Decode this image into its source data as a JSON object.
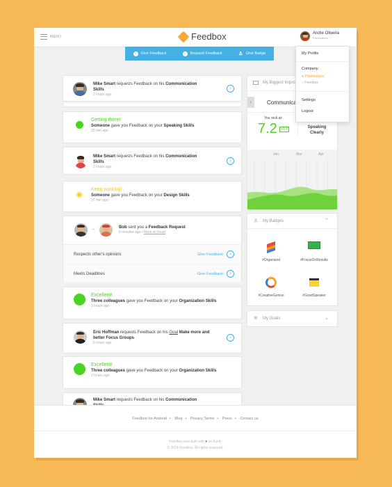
{
  "header": {
    "menu_label": "MENU",
    "logo_text": "Feedbox",
    "user_name": "Andre Oliveira",
    "user_company": "Pixelmatters"
  },
  "dropdown": {
    "my_profile": "My Profile",
    "company_label": "Company:",
    "company_active": "Pixelmatters",
    "company_other": "Feedbox",
    "settings": "Settings",
    "logout": "Logout"
  },
  "actions": {
    "give": "Give Feedback",
    "request": "Request Feedback",
    "badge": "Give Badge"
  },
  "feed": [
    {
      "name": "Mike Smart",
      "mid": " requests Feedback on his ",
      "topic": "Communication Skills",
      "time": "2 hours ago"
    },
    {
      "title": "Getting there!",
      "pre": "Someone",
      "mid": " gave you Feedback on your ",
      "topic": "Speaking Skills",
      "time": "25 min ago"
    },
    {
      "name": "Mike Smart",
      "mid": " requests Feedback on his ",
      "topic": "Communication Skills",
      "time": "2 hours ago"
    },
    {
      "title": "Keep working!",
      "pre": "Someone",
      "mid": " gave you Feedback on your ",
      "topic": "Design Skills",
      "time": "37 min ago"
    },
    {
      "name": "Bob",
      "mid": " sent you a ",
      "topic": "Feedback Request",
      "time": "6 minutes ago",
      "mark": "Mark as Read",
      "row1": "Respects other's opinions",
      "row2": "Meets Deadlines",
      "give": "Give Feedback"
    },
    {
      "title": "Excellent!",
      "pre": "Three colleagues",
      "mid": " gave you Feedback on your ",
      "topic": "Organization Skills",
      "time": "2 hours ago"
    },
    {
      "name": "Eric Hoffman",
      "mid": " requests Feedback on his ",
      "goal": "Goal",
      "topic": "Make more and better Focus Groups",
      "time": "5 hours ago"
    },
    {
      "title": "Excellent!",
      "pre": "Three colleagues",
      "mid": " gave you Feedback on your ",
      "topic": "Organization Skills",
      "time": "2 hours ago"
    },
    {
      "name": "Mike Smart",
      "mid": " requests Feedback on his ",
      "topic": "Communication Skills",
      "time": "2 hours ago"
    }
  ],
  "improvement": {
    "header": "My Biggest Improvement",
    "title": "Communication",
    "rock_label": "You rock at:",
    "score": "7.2",
    "delta": "+0.4",
    "skill": "Speaking Clearly",
    "months": [
      "Jan",
      "Mar",
      "Apr"
    ]
  },
  "badges": {
    "header": "My Badges",
    "items": [
      "#Organized",
      "#FocusOnResults",
      "#CreativeGenius",
      "#GoodSpeaker"
    ]
  },
  "goals": {
    "header": "My Goals"
  },
  "footer": {
    "links": [
      "Feedbox for Android",
      "Blog",
      "Privacy Terms",
      "Press",
      "Contact us"
    ],
    "built_pre": "Feedbox was built with",
    "built_post": "on Earth",
    "copyright": "© 2014 Feedbox. All rights reserved."
  },
  "colors": {
    "accent": "#44b0e3",
    "green": "#4bd321",
    "yellow": "#f8d230",
    "orange": "#f7a83c",
    "background": "#f7b955"
  }
}
